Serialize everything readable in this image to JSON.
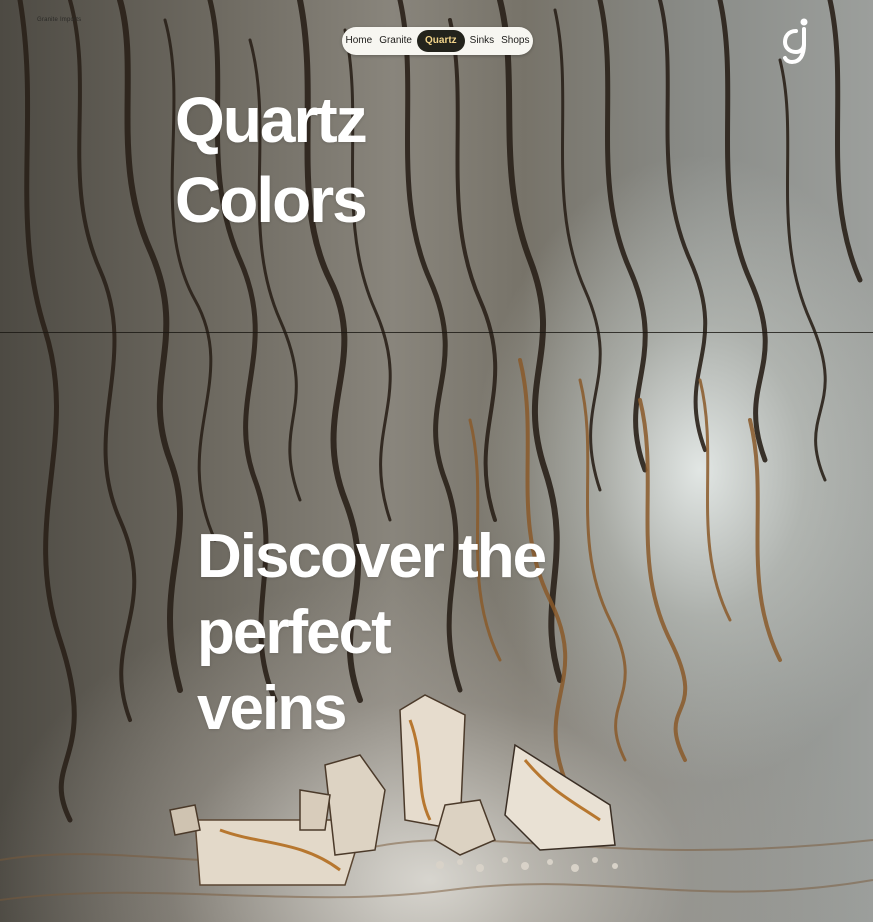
{
  "brand": {
    "small_text": "Granite Imports",
    "logo_icon": "gi-logo-icon"
  },
  "nav": {
    "items": [
      {
        "label": "Home",
        "active": false
      },
      {
        "label": "Granite",
        "active": false
      },
      {
        "label": "Quartz",
        "active": true
      },
      {
        "label": "Sinks",
        "active": false
      },
      {
        "label": "Shops",
        "active": false
      }
    ]
  },
  "hero": {
    "title": "Quartz\nColors",
    "tagline": "Discover the\nperfect\nveins",
    "background_image": "marble-wall-with-quartz-rocks"
  },
  "colors": {
    "active_nav_bg": "#23231c",
    "active_nav_text": "#f2d48a",
    "nav_bg": "#f7f6f1",
    "heading_text": "#ffffff"
  }
}
